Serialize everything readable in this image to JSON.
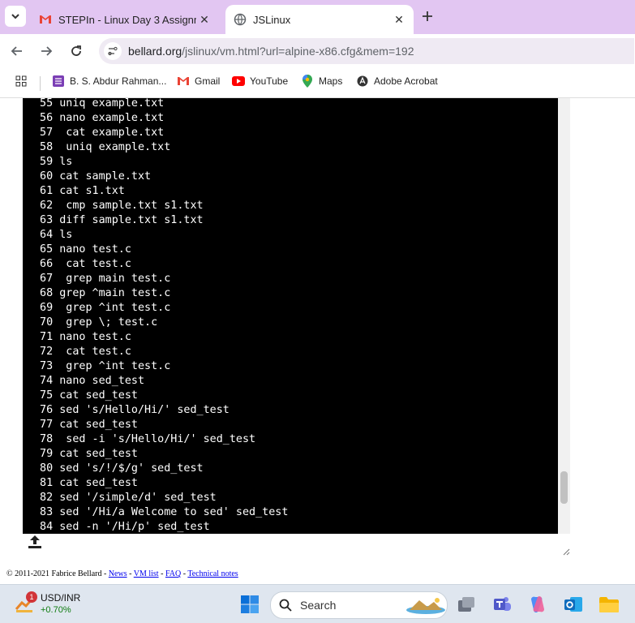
{
  "tabs": [
    {
      "title": "STEPIn - Linux Day 3 Assignmen",
      "icon": "gmail-icon",
      "active": false
    },
    {
      "title": "JSLinux",
      "icon": "globe-icon",
      "active": true
    }
  ],
  "address": {
    "host": "bellard.org",
    "path": "/jslinux/vm.html?url=alpine-x86.cfg&mem=192"
  },
  "bookmarks": [
    {
      "label": "B. S. Abdur Rahman...",
      "icon": "bookmark-app-icon"
    },
    {
      "label": "Gmail",
      "icon": "gmail-icon"
    },
    {
      "label": "YouTube",
      "icon": "youtube-icon"
    },
    {
      "label": "Maps",
      "icon": "maps-icon"
    },
    {
      "label": "Adobe Acrobat",
      "icon": "acrobat-icon"
    }
  ],
  "terminal": {
    "lines": [
      " 55 uniq example.txt",
      " 56 nano example.txt",
      " 57  cat example.txt",
      " 58  uniq example.txt",
      " 59 ls",
      " 60 cat sample.txt",
      " 61 cat s1.txt",
      " 62  cmp sample.txt s1.txt",
      " 63 diff sample.txt s1.txt",
      " 64 ls",
      " 65 nano test.c",
      " 66  cat test.c",
      " 67  grep main test.c",
      " 68 grep ^main test.c",
      " 69  grep ^int test.c",
      " 70  grep \\; test.c",
      " 71 nano test.c",
      " 72  cat test.c",
      " 73  grep ^int test.c",
      " 74 nano sed_test",
      " 75 cat sed_test",
      " 76 sed 's/Hello/Hi/' sed_test",
      " 77 cat sed_test",
      " 78  sed -i 's/Hello/Hi/' sed_test",
      " 79 cat sed_test",
      " 80 sed 's/!/$/g' sed_test",
      " 81 cat sed_test",
      " 82 sed '/simple/d' sed_test",
      " 83 sed '/Hi/a Welcome to sed' sed_test",
      " 84 sed -n '/Hi/p' sed_test"
    ]
  },
  "footer": {
    "copyright": "© 2011-2021 Fabrice Bellard - ",
    "news": "News",
    "sep1": " - ",
    "vmlist": "VM list",
    "sep2": " - ",
    "faq": "FAQ",
    "sep3": " - ",
    "technotes": "Technical notes"
  },
  "taskbar": {
    "weather_title": "USD/INR",
    "weather_change": "+0.70%",
    "badge": "1",
    "search_label": "Search"
  },
  "colors": {
    "tabstrip": "#e2c6f2",
    "terminal_bg": "#000000",
    "terminal_fg": "#ffffff",
    "positive": "#107c10"
  }
}
